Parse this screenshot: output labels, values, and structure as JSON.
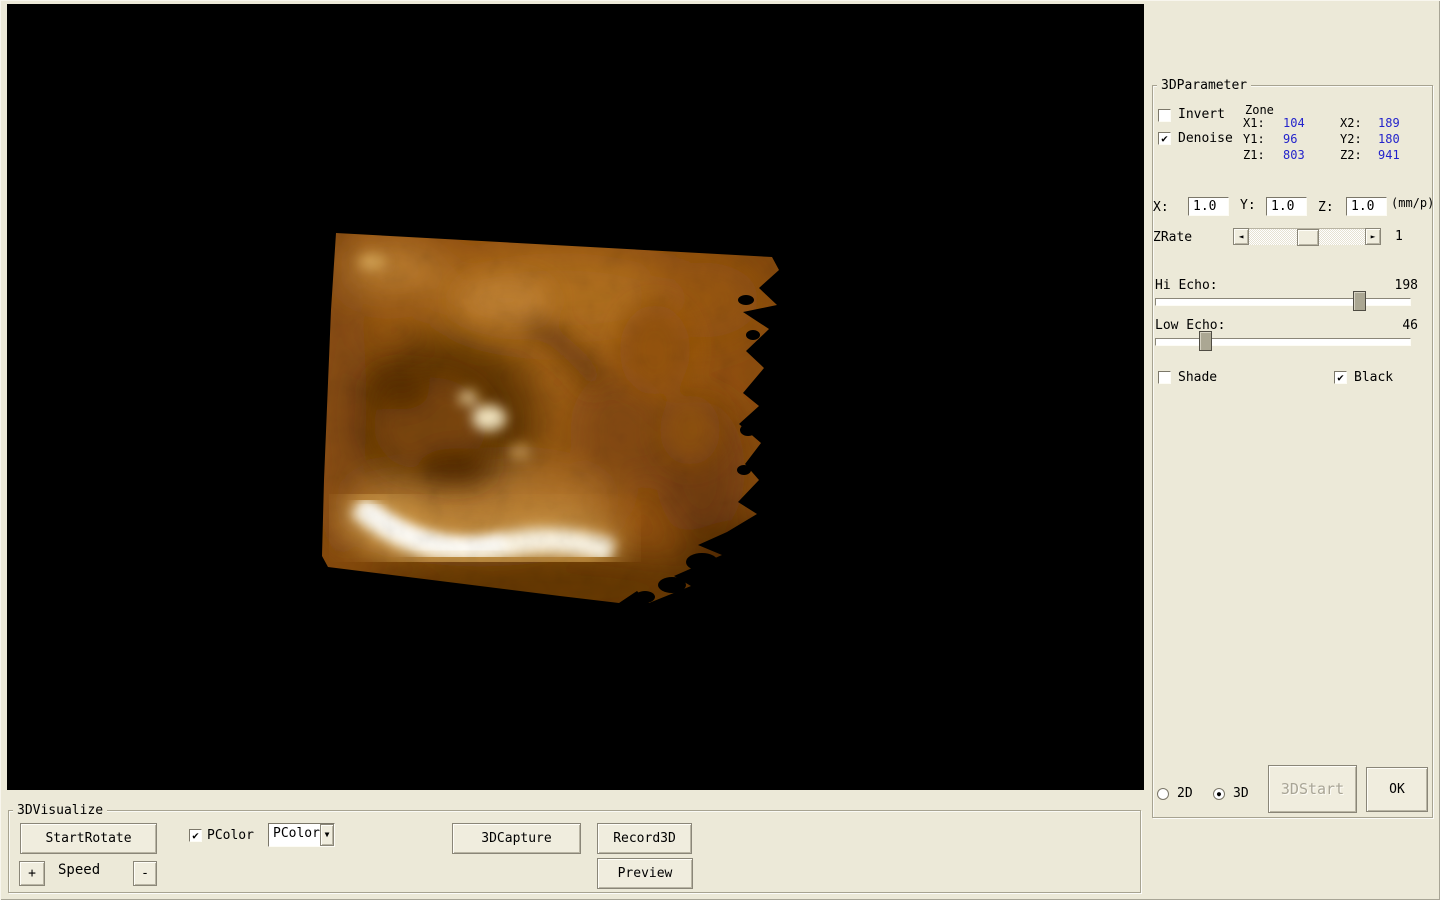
{
  "colors": {
    "window_bg": "#ece9d8",
    "viewport_bg": "#000000",
    "value_text": "#2323cb",
    "volume_amber": "#a05f16",
    "volume_highlight": "#fdf8ee"
  },
  "icons": {
    "check": "✔",
    "radio_dot": "●",
    "dropdown_arrow": "▼",
    "scroll_left": "◄",
    "scroll_right": "►"
  },
  "right_panel": {
    "title": "3DParameter",
    "invert": {
      "label": "Invert",
      "glyph": ""
    },
    "denoise": {
      "label": "Denoise",
      "glyph": "✔"
    },
    "zone": {
      "title": "Zone",
      "x1_label": "X1:",
      "x1": "104",
      "x2_label": "X2:",
      "x2": "189",
      "y1_label": "Y1:",
      "y1": "96",
      "y2_label": "Y2:",
      "y2": "180",
      "z1_label": "Z1:",
      "z1": "803",
      "z2_label": "Z2:",
      "z2": "941"
    },
    "scale": {
      "x_label": "X:",
      "x": "1.0",
      "y_label": "Y:",
      "y": "1.0",
      "z_label": "Z:",
      "z": "1.0",
      "unit": "(mm/p)"
    },
    "zrate": {
      "label": "ZRate",
      "value": "1"
    },
    "hi_echo": {
      "label": "Hi Echo:",
      "value": "198",
      "percent": 77.3
    },
    "low_echo": {
      "label": "Low Echo:",
      "value": "46",
      "percent": 17.3
    },
    "shade": {
      "label": "Shade",
      "glyph": ""
    },
    "black": {
      "label": "Black",
      "glyph": "✔"
    },
    "mode_2d": {
      "label": "2D",
      "dot": ""
    },
    "mode_3d": {
      "label": "3D",
      "dot": "●"
    },
    "start_button": "3DStart",
    "ok_button": "OK"
  },
  "bottom_panel": {
    "title": "3DVisualize",
    "start_rotate": "StartRotate",
    "pcolor": {
      "label": "PColor",
      "glyph": "✔"
    },
    "pcolor_dropdown": {
      "value": "PColor"
    },
    "capture": "3DCapture",
    "record": "Record3D",
    "preview": "Preview",
    "speed_plus": "+",
    "speed_label": "Speed",
    "speed_minus": "-"
  }
}
